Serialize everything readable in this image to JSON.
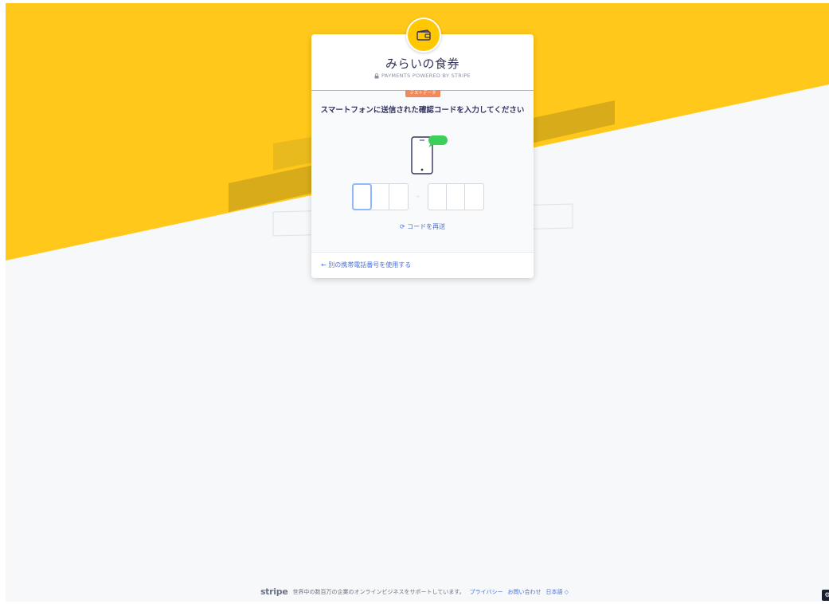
{
  "merchant": {
    "name": "みらいの食券",
    "powered_by": "PAYMENTS POWERED BY STRIPE",
    "test_badge": "テストデータ",
    "logo_icon": "wallet-icon",
    "accent_color": "#ffc800"
  },
  "verification": {
    "instruction": "スマートフォンに送信された確認コードを入力してください",
    "code_digits": [
      "",
      "",
      "",
      "",
      "",
      ""
    ],
    "resend_label": "コードを再送",
    "resend_icon": "refresh-icon",
    "alt_phone_label": "← 別の携帯電話番号を使用する"
  },
  "footer": {
    "brand": "stripe",
    "tagline": "世界中の数百万の企業のオンラインビジネスをサポートしています。",
    "privacy": "プライバシー",
    "contact": "お問い合わせ",
    "language": "日本語 ◇"
  }
}
